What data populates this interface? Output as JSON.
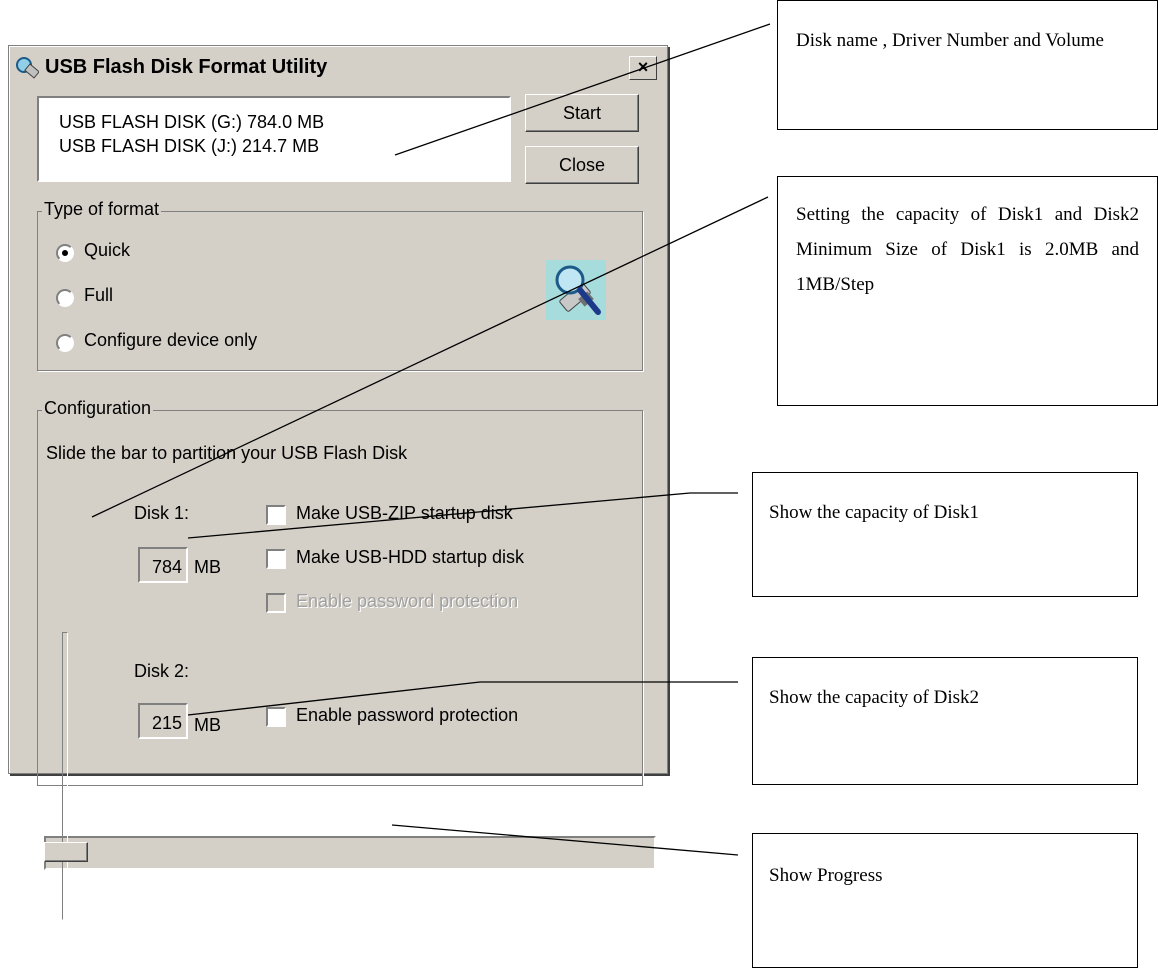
{
  "window": {
    "title": "USB Flash Disk Format Utility",
    "close_glyph": "×",
    "icon": "usb-utility-icon"
  },
  "disk_list": [
    "USB FLASH DISK (G:)  784.0 MB",
    "USB FLASH DISK (J:)  214.7 MB"
  ],
  "buttons": {
    "start": "Start",
    "close": "Close"
  },
  "format_group": {
    "label": "Type of format",
    "options": [
      "Quick",
      "Full",
      "Configure device only"
    ],
    "selected": "Quick",
    "illustration": "usb-search-icon"
  },
  "config_group": {
    "label": "Configuration",
    "instruction": "Slide the bar to partition your USB Flash Disk",
    "disk1": {
      "label": "Disk 1:",
      "size": "784",
      "unit": "MB",
      "options": [
        "Make USB-ZIP startup disk",
        "Make USB-HDD startup disk"
      ],
      "disabled_option": "Enable password protection"
    },
    "disk2": {
      "label": "Disk 2:",
      "size": "215",
      "unit": "MB",
      "option": "Enable password protection"
    },
    "slider_level": 0.784
  },
  "progress": {
    "value": 0
  },
  "callouts": {
    "disk_name": "Disk name , Driver Number and Volume",
    "capacity": "Setting the capacity of Disk1 and Disk2 Minimum Size of Disk1 is 2.0MB and 1MB/Step",
    "disk1": "Show the capacity of Disk1",
    "disk2": "Show the capacity of Disk2",
    "progress": "Show Progress"
  }
}
